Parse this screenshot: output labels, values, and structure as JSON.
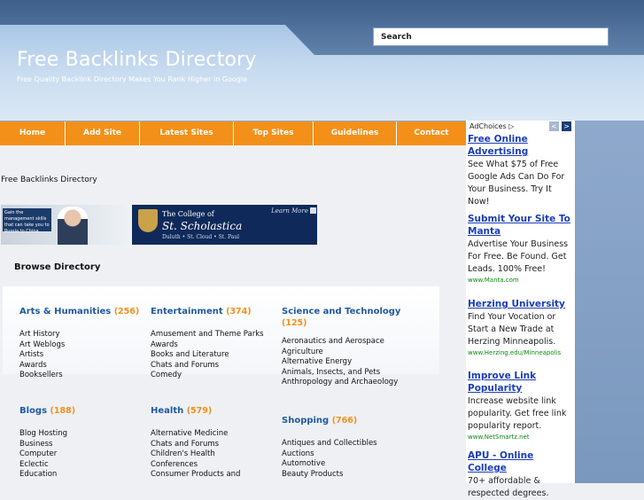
{
  "header": {
    "title": "Free Backlinks Directory",
    "tagline": "Free Quality Backlink Directory Makes You Rank Higher in Google",
    "search_label": "Search"
  },
  "nav": [
    "Home",
    "Add Site",
    "Latest Sites",
    "Top Sites",
    "Guidelines",
    "Contact"
  ],
  "breadcrumb": "Free Backlinks Directory",
  "banner": {
    "promo": "Gain the management skills that can take you to Russia to China",
    "line1": "The College of",
    "line2": "St. Scholastica",
    "line3": "Duluth  •  St. Cloud  •  St. Paul",
    "learn": "Learn More"
  },
  "browse_title": "Browse Directory",
  "categories": [
    {
      "title": "Arts & Humanities",
      "count": "(256)",
      "subs": [
        "Art History",
        "Art Weblogs",
        "Artists",
        "Awards",
        "Booksellers"
      ]
    },
    {
      "title": "Entertainment",
      "count": "(374)",
      "subs": [
        "Amusement and Theme Parks",
        "Awards",
        "Books and Literature",
        "Chats and Forums",
        "Comedy"
      ]
    },
    {
      "title": "Science and Technology",
      "count": "(125)",
      "subs": [
        "Aeronautics and Aerospace",
        "Agriculture",
        "Alternative Energy",
        "Animals, Insects, and Pets",
        "Anthropology and Archaeology"
      ]
    },
    {
      "title": "Blogs",
      "count": "(188)",
      "subs": [
        "Blog Hosting",
        "Business",
        "Computer",
        "Eclectic",
        "Education"
      ]
    },
    {
      "title": "Health",
      "count": "(579)",
      "subs": [
        "Alternative Medicine",
        "Chats and Forums",
        "Children's Health",
        "Conferences",
        "Consumer Products and"
      ]
    },
    {
      "title": "Shopping",
      "count": "(766)",
      "subs": [
        "Antiques and Collectibles",
        "Auctions",
        "Automotive",
        "Beauty Products"
      ]
    }
  ],
  "ads": {
    "adchoices": "AdChoices ▷",
    "prev": "<",
    "next": ">",
    "items": [
      {
        "title": "Free Online Advertising",
        "body": "See What $75 of Free Google Ads Can Do For Your Business. Try It Now!",
        "url": ""
      },
      {
        "title": "Submit Your Site To Manta",
        "body": "Advertise Your Business For Free. Be Found. Get Leads. 100% Free!",
        "url": "www.Manta.com"
      },
      {
        "title": "Herzing University",
        "body": "Find Your Vocation or Start a New Trade at Herzing Minneapolis.",
        "url": "www.Herzing.edu/Minneapolis"
      },
      {
        "title": "Improve Link Popularity",
        "body": "Increase website link popularity. Get free link popularity report.",
        "url": "www.NetSmartz.net"
      },
      {
        "title": "APU - Online College",
        "body": "70+ affordable & respected degrees.",
        "url": ""
      }
    ]
  }
}
